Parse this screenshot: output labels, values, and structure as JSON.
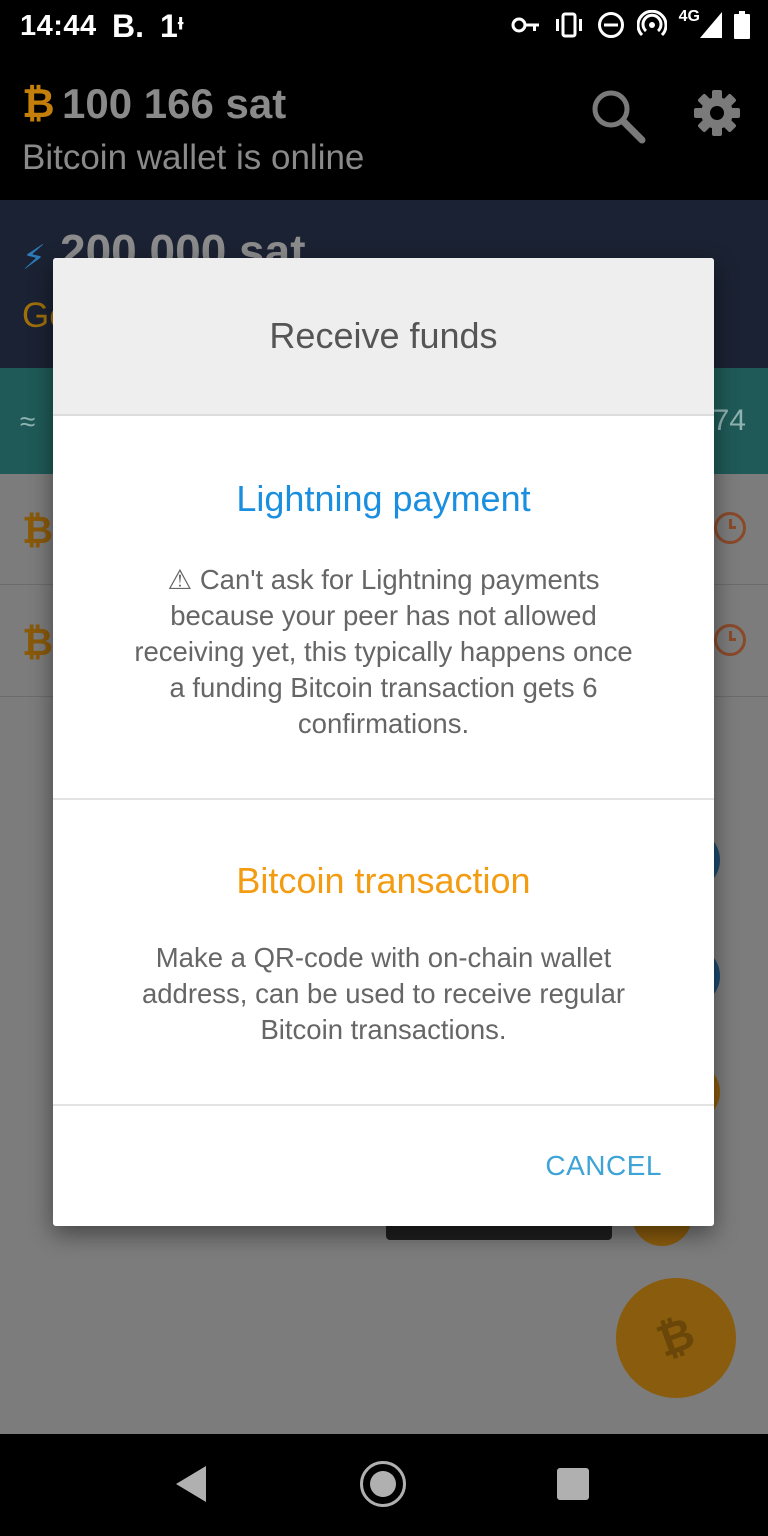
{
  "status_bar": {
    "time": "14:44",
    "app_icon_1": "B.",
    "app_icon_2": "1ᶧ",
    "network": "4G",
    "icons": [
      "vpn-key-icon",
      "vibrate-icon",
      "do-not-disturb-icon",
      "hotspot-icon",
      "signal-icon",
      "battery-icon"
    ]
  },
  "app_bar": {
    "btc_symbol": "₿",
    "balance": "100 166 sat",
    "status": "Bitcoin wallet is online"
  },
  "lightning_card": {
    "bolt_symbol": "⚡",
    "amount": "200 000 sat",
    "sub_partial": "Ge"
  },
  "teal_bar": {
    "approx_symbol": "≈",
    "number_partial": "74"
  },
  "list": {
    "rows": [
      {
        "symbol": "₿"
      },
      {
        "symbol": "₿"
      }
    ]
  },
  "dialog": {
    "title": "Receive funds",
    "lightning_option": {
      "title": "Lightning payment",
      "description": "⚠ Can't ask for Lightning payments because your peer has not allowed receiving yet, this typically happens once a funding Bitcoin transaction gets 6 confirmations."
    },
    "bitcoin_option": {
      "title": "Bitcoin transaction",
      "description": "Make a QR-code with on-chain wallet address, can be used to receive regular Bitcoin transactions."
    },
    "cancel_label": "CANCEL"
  },
  "fab": {
    "symbol": "₿"
  },
  "colors": {
    "lightning_blue": "#1a8fe0",
    "bitcoin_orange": "#f39c12",
    "cancel_blue": "#3ea3d6"
  }
}
